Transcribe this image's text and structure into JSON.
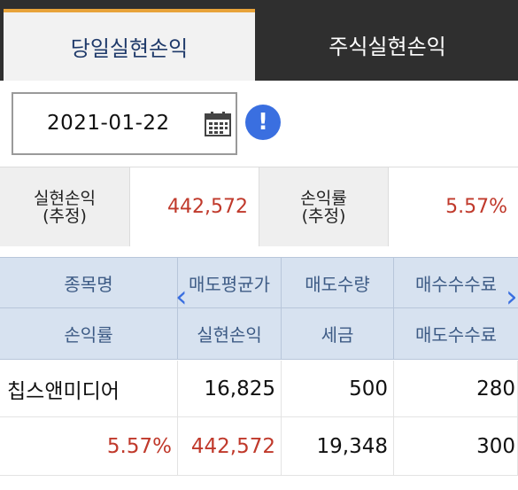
{
  "tabs": [
    {
      "label": "당일실현손익",
      "active": true
    },
    {
      "label": "주식실현손익",
      "active": false
    }
  ],
  "date": {
    "value": "2021-01-22"
  },
  "icons": {
    "calendar": "calendar-icon",
    "info": "info-icon",
    "info_glyph": "!"
  },
  "summary": {
    "realized_label_1": "실현손익",
    "realized_label_2": "(추정)",
    "realized_value": "442,572",
    "rate_label_1": "손익률",
    "rate_label_2": "(추정)",
    "rate_value": "5.57%"
  },
  "table": {
    "headers_row1": [
      "종목명",
      "매도평균가",
      "매도수량",
      "매수수수료"
    ],
    "headers_row2": [
      "손익률",
      "실현손익",
      "세금",
      "매도수수료"
    ],
    "rows": [
      {
        "name": "칩스앤미디어",
        "sell_avg_price": "16,825",
        "sell_qty": "500",
        "buy_fee": "280"
      },
      {
        "rate": "5.57%",
        "realized": "442,572",
        "tax": "19,348",
        "sell_fee": "300"
      }
    ],
    "nav_prev": "‹",
    "nav_next": "›"
  },
  "colors": {
    "accent_orange": "#e8a33a",
    "header_blue": "#d7e2f0",
    "loss_red": "#c0392b",
    "icon_blue": "#3a6fe0"
  }
}
